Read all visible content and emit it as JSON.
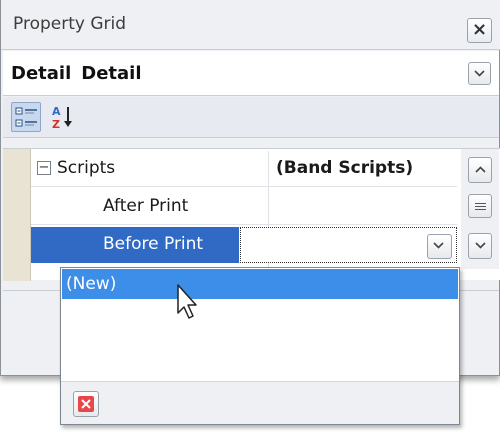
{
  "window": {
    "title": "Property Grid",
    "close_glyph": "×"
  },
  "object_selector": {
    "name": "Detail",
    "type": "Detail"
  },
  "toolbar": {
    "categorized_icon": "categorized-view-icon",
    "alphabetical_icon": "sort-az-icon"
  },
  "grid": {
    "category": {
      "expander_glyph": "−",
      "label": "Scripts",
      "value": "(Band Scripts)"
    },
    "properties": [
      {
        "name": "After Print",
        "value": ""
      },
      {
        "name": "Before Print",
        "value": "",
        "selected": true
      }
    ]
  },
  "dropdown": {
    "items": [
      "(New)"
    ],
    "selected_index": 0,
    "remove_icon": "remove-icon"
  },
  "colors": {
    "selection": "#316ac5",
    "dropdown_highlight": "#3d8ee8",
    "remove_button": "#e8474a",
    "gutter": "#e9e3d3"
  }
}
